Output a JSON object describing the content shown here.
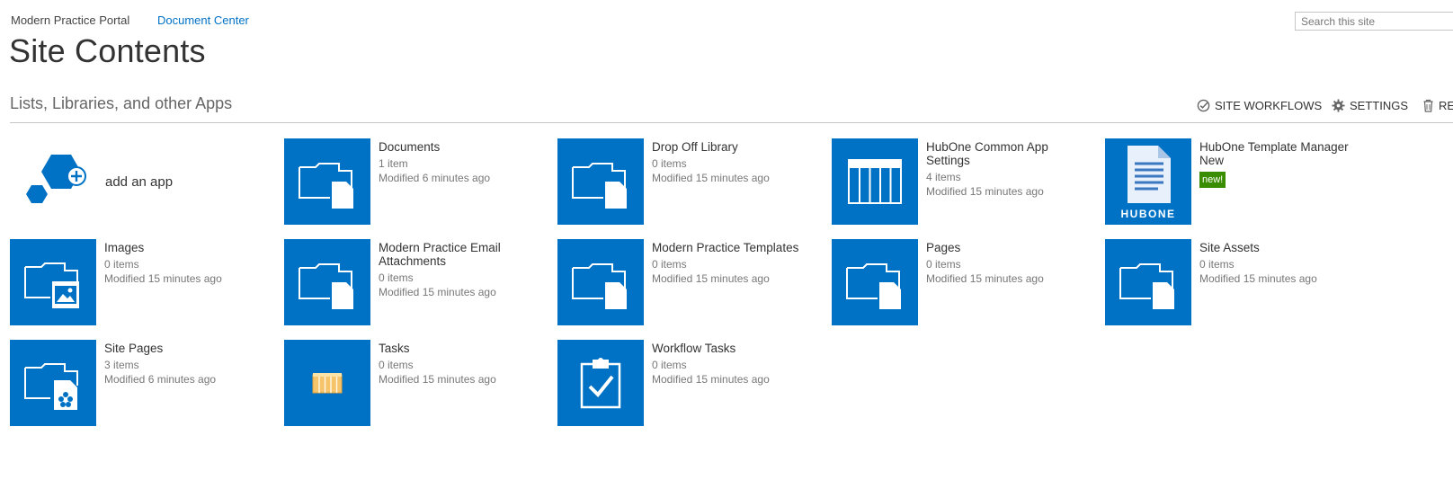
{
  "nav": {
    "site": "Modern Practice Portal",
    "current": "Document Center"
  },
  "search": {
    "placeholder": "Search this site"
  },
  "page_title": "Site Contents",
  "section_title": "Lists, Libraries, and other Apps",
  "actions": {
    "workflows": "SITE WORKFLOWS",
    "settings": "SETTINGS",
    "recycle": "REC"
  },
  "add_app": "add an app",
  "tiles": [
    {
      "name": "Documents",
      "items": "1 item",
      "modified": "Modified 6 minutes ago",
      "icon": "folder-doc-icon"
    },
    {
      "name": "Drop Off Library",
      "items": "0 items",
      "modified": "Modified 15 minutes ago",
      "icon": "folder-doc-icon"
    },
    {
      "name": "HubOne Common App Settings",
      "items": "4 items",
      "modified": "Modified 15 minutes ago",
      "icon": "list-grid-icon"
    },
    {
      "name": "HubOne Template Manager New",
      "badge": "new!",
      "icon": "hubone-logo",
      "logo_text": "HubOne"
    },
    {
      "name": "Images",
      "items": "0 items",
      "modified": "Modified 15 minutes ago",
      "icon": "folder-image-icon"
    },
    {
      "name": "Modern Practice Email Attachments",
      "items": "0 items",
      "modified": "Modified 15 minutes ago",
      "icon": "folder-doc-icon"
    },
    {
      "name": "Modern Practice Templates",
      "items": "0 items",
      "modified": "Modified 15 minutes ago",
      "icon": "folder-doc-icon"
    },
    {
      "name": "Pages",
      "items": "0 items",
      "modified": "Modified 15 minutes ago",
      "icon": "folder-doc-icon"
    },
    {
      "name": "Site Assets",
      "items": "0 items",
      "modified": "Modified 15 minutes ago",
      "icon": "folder-doc-icon"
    },
    {
      "name": "Site Pages",
      "items": "3 items",
      "modified": "Modified 6 minutes ago",
      "icon": "folder-sitepage-icon"
    },
    {
      "name": "Tasks",
      "items": "0 items",
      "modified": "Modified 15 minutes ago",
      "icon": "tasks-icon"
    },
    {
      "name": "Workflow Tasks",
      "items": "0 items",
      "modified": "Modified 15 minutes ago",
      "icon": "clipboard-check-icon"
    }
  ]
}
